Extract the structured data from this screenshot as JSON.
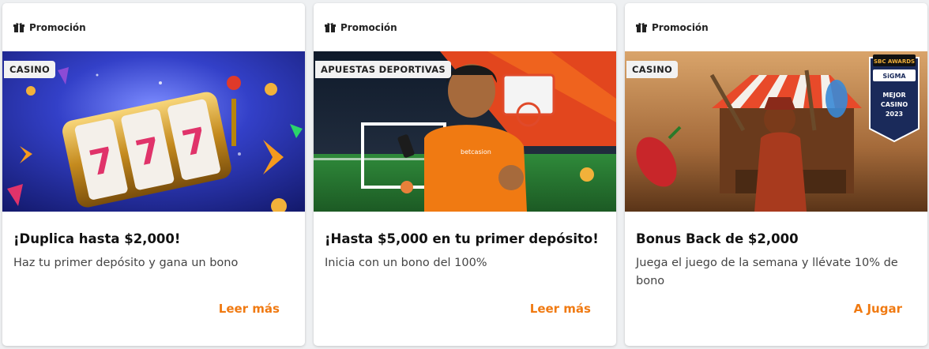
{
  "cards": [
    {
      "header_label": "Promoción",
      "badge": "CASINO",
      "title": "¡Duplica hasta $2,000!",
      "description": "Haz tu primer depósito y gana un bono",
      "cta": "Leer más"
    },
    {
      "header_label": "Promoción",
      "badge": "APUESTAS DEPORTIVAS",
      "title": "¡Hasta $5,000 en tu primer depósito!",
      "description": "Inicia con un bono del 100%",
      "cta": "Leer más",
      "jersey_text": "betcasion"
    },
    {
      "header_label": "Promoción",
      "badge": "CASINO",
      "title": "Bonus Back de $2,000",
      "description": "Juega el juego de la semana y llévate 10% de bono",
      "cta": "A Jugar",
      "award": {
        "line1": "SBC AWARDS",
        "line2": "SiGMA",
        "line3": "MEJOR",
        "line4": "CASINO",
        "line5": "2023"
      }
    }
  ],
  "colors": {
    "accent": "#f07a12",
    "card_bg": "#ffffff",
    "page_bg": "#eef0f2"
  }
}
